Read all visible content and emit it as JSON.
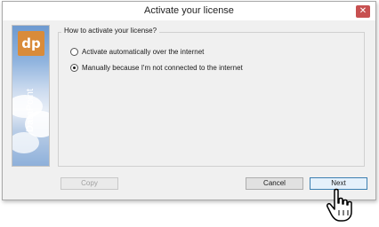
{
  "window": {
    "title": "Activate your license",
    "close_glyph": "✕"
  },
  "banner": {
    "logo_text": "dp",
    "brand_part1": "Data",
    "brand_part2": "Point",
    "logo_color": "#d98b3a"
  },
  "group": {
    "title": "How to activate your license?"
  },
  "options": [
    {
      "label": "Activate automatically over the internet",
      "selected": false
    },
    {
      "label": "Manually because I'm not connected to the internet",
      "selected": true
    }
  ],
  "buttons": {
    "copy": "Copy",
    "cancel": "Cancel",
    "next": "Next"
  },
  "cursor": {
    "icon": "hand-pointer-icon"
  }
}
